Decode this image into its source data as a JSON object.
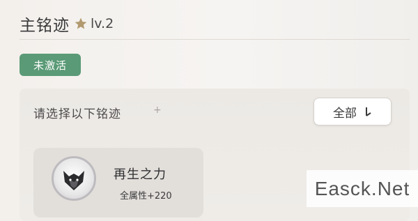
{
  "header": {
    "title": "主铭迹",
    "level": "lv.2",
    "star_icon": "star-icon",
    "star_color": "#b29a6e"
  },
  "status_badge": {
    "label": "未激活",
    "color": "#5a9a76"
  },
  "selection": {
    "prompt": "请选择以下铭迹",
    "plus_symbol": "+",
    "filter_button": {
      "label": "全部",
      "icon": "sort-down-icon"
    }
  },
  "inscription_card": {
    "name": "再生之力",
    "stat": "全属性+220",
    "emblem_icon": "fox-emblem-icon"
  },
  "watermark": {
    "text": "Easck.Net"
  }
}
